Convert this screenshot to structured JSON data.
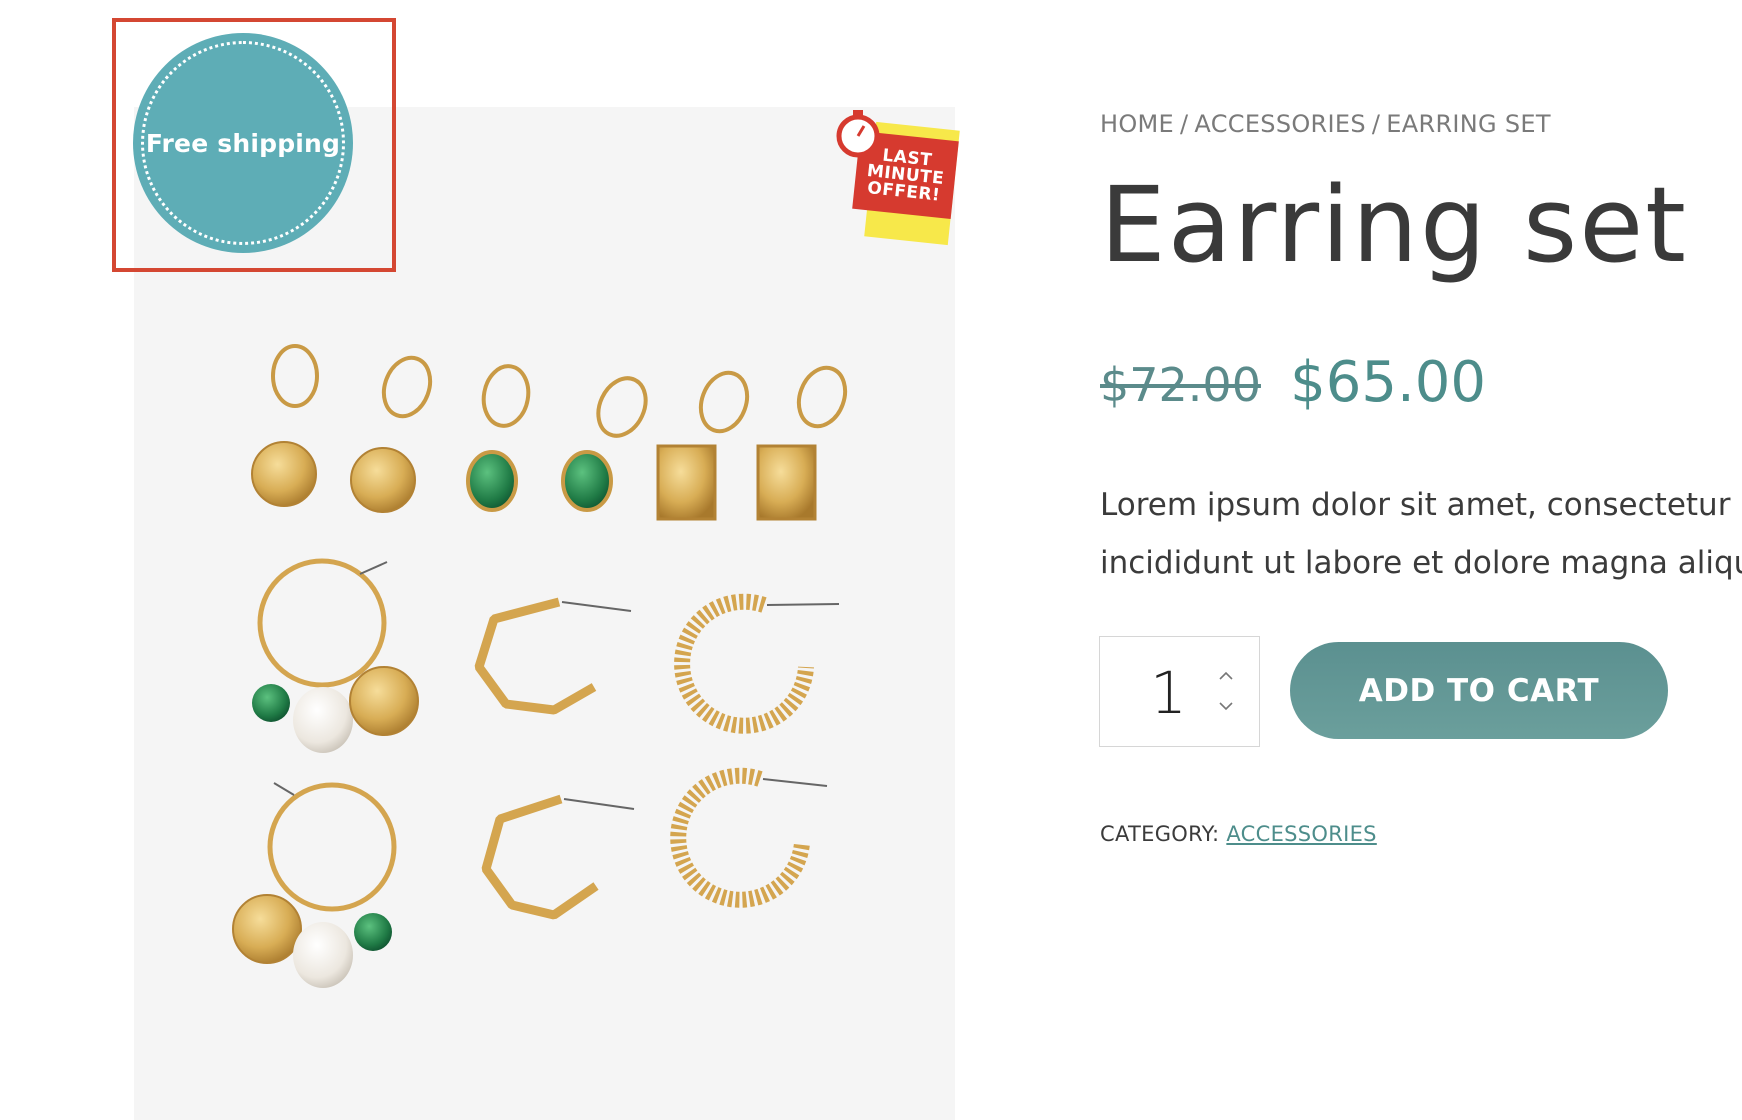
{
  "badges": {
    "free_shipping": "Free shipping",
    "offer_lines": [
      "LAST",
      "MINUTE",
      "OFFER!"
    ]
  },
  "breadcrumb": {
    "items": [
      "HOME",
      "ACCESSORIES",
      "EARRING SET"
    ],
    "separator": "/"
  },
  "product": {
    "title": "Earring set",
    "price_old": "$72.00",
    "price_new": "$65.00",
    "description_line1": "Lorem ipsum dolor sit amet, consectetur adipiscing elit, sed do eiusmod tempor",
    "description_line2": "incididunt ut labore et dolore magna aliqua.",
    "quantity": "1",
    "add_to_cart_label": "ADD TO CART",
    "category_label": "CATEGORY:",
    "category_value": "ACCESSORIES"
  },
  "colors": {
    "accent": "#4d8d8b",
    "badge_teal": "#5eadb6",
    "highlight_red": "#d44732",
    "offer_red": "#d63a2f",
    "offer_yellow": "#f7e84a",
    "gold": "#d9b25f",
    "green_stone": "#2f8a55"
  }
}
